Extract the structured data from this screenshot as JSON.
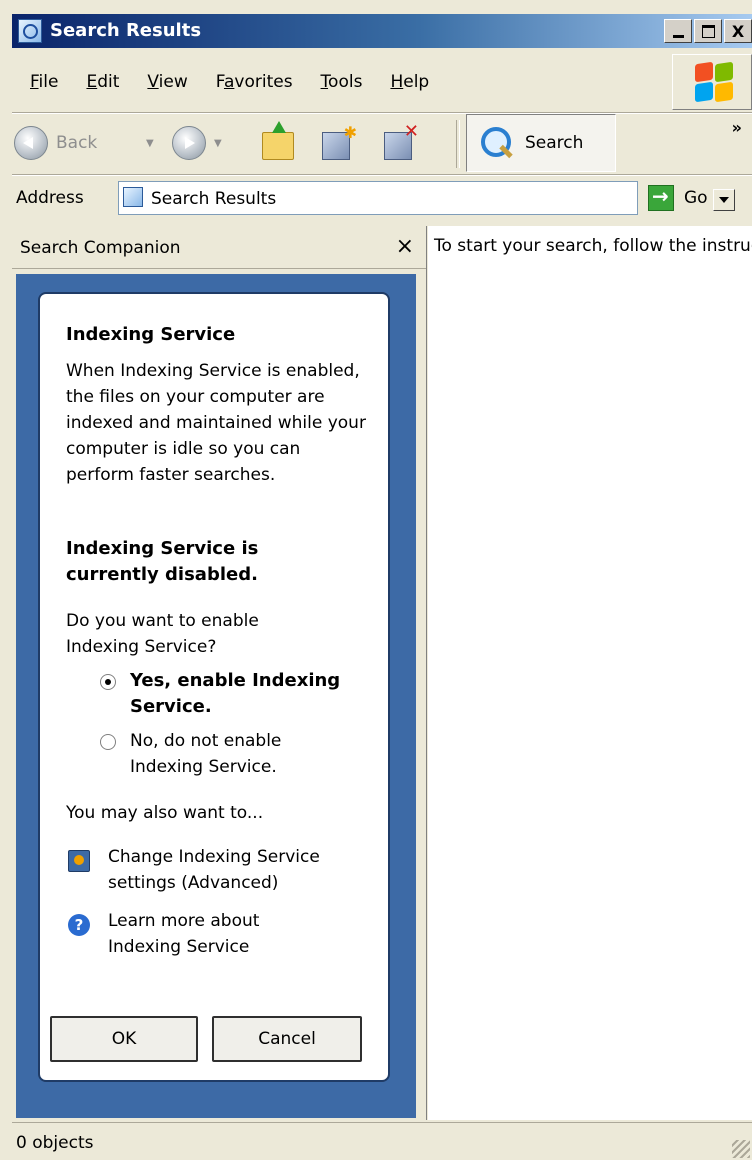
{
  "window": {
    "title": "Search Results",
    "caption_buttons": {
      "minimize": "_",
      "maximize": "□",
      "close": "X"
    }
  },
  "menu": {
    "items": [
      {
        "label": "File",
        "access": "F"
      },
      {
        "label": "Edit",
        "access": "E"
      },
      {
        "label": "View",
        "access": "V"
      },
      {
        "label": "Favorites",
        "access": "a"
      },
      {
        "label": "Tools",
        "access": "T"
      },
      {
        "label": "Help",
        "access": "H"
      }
    ]
  },
  "toolbar": {
    "back_label": "Back",
    "search_label": "Search",
    "overflow": "»"
  },
  "address": {
    "label": "Address",
    "value": "Search Results",
    "go_label": "Go"
  },
  "companion": {
    "title": "Search Companion",
    "close": "×",
    "heading": "Indexing Service",
    "description": "When Indexing Service is enabled, the files on your computer are indexed and maintained while your computer is idle so you can perform faster searches.",
    "status": "Indexing Service is currently disabled.",
    "question": "Do you want to enable Indexing Service?",
    "options": [
      {
        "label": "Yes, enable Indexing Service.",
        "selected": true
      },
      {
        "label": "No, do not enable Indexing Service.",
        "selected": false
      }
    ],
    "also_label": "You may also want to...",
    "links": [
      {
        "label": "Change Indexing Service settings (Advanced)",
        "icon": "settings-icon"
      },
      {
        "label": "Learn more about Indexing Service",
        "icon": "help-icon"
      }
    ],
    "ok_label": "OK",
    "cancel_label": "Cancel"
  },
  "results": {
    "message": "To start your search, follow the instructions in the left pane."
  },
  "status": {
    "text": "0 objects"
  }
}
